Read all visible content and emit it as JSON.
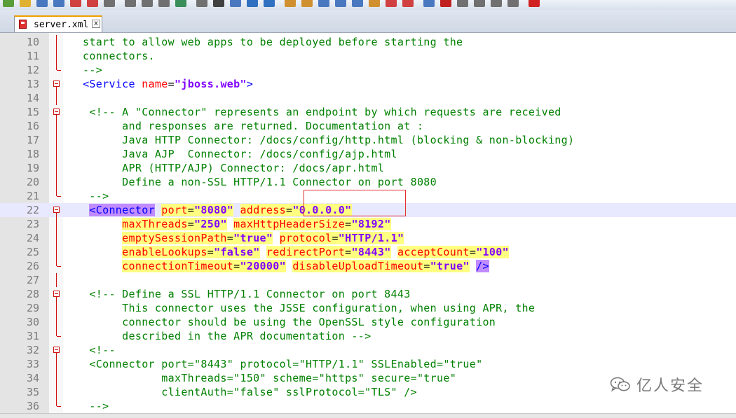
{
  "tab": {
    "filename": "server.xml",
    "close_label": "x"
  },
  "watermark": {
    "text": "亿人安全"
  },
  "colors": {
    "comment": "#008000",
    "tag": "#0000ff",
    "attribute": "#ff0000",
    "value": "#8000ff",
    "line_highlight": "#e8e8ff",
    "match_highlight": "#ffff80",
    "tag_match": "#c08cff",
    "annotation_box": "#e03030"
  },
  "lines": [
    {
      "n": "10",
      "fold": "mid",
      "toks": [
        [
          "cm",
          "   start to allow web apps to be deployed before starting the"
        ]
      ]
    },
    {
      "n": "11",
      "fold": "mid",
      "toks": [
        [
          "cm",
          "   connectors."
        ]
      ]
    },
    {
      "n": "12",
      "fold": "end",
      "toks": [
        [
          "cm",
          "   -->"
        ]
      ]
    },
    {
      "n": "13",
      "fold": "box",
      "toks": [
        [
          "pl",
          "   "
        ],
        [
          "tag",
          "<Service "
        ],
        [
          "attr",
          "name"
        ],
        [
          "eq",
          "="
        ],
        [
          "val",
          "\"jboss.web\""
        ],
        [
          "tag",
          ">"
        ]
      ]
    },
    {
      "n": "14",
      "fold": "mid",
      "toks": []
    },
    {
      "n": "15",
      "fold": "box",
      "toks": [
        [
          "cm",
          "    <!-- A \"Connector\" represents an endpoint by which requests are received"
        ]
      ]
    },
    {
      "n": "16",
      "fold": "mid",
      "toks": [
        [
          "cm",
          "         and responses are returned. Documentation at :"
        ]
      ]
    },
    {
      "n": "17",
      "fold": "mid",
      "toks": [
        [
          "cm",
          "         Java HTTP Connector: /docs/config/http.html (blocking & non-blocking)"
        ]
      ]
    },
    {
      "n": "18",
      "fold": "mid",
      "toks": [
        [
          "cm",
          "         Java AJP  Connector: /docs/config/ajp.html"
        ]
      ]
    },
    {
      "n": "19",
      "fold": "mid",
      "toks": [
        [
          "cm",
          "         APR (HTTP/AJP) Connector: /docs/apr.html"
        ]
      ]
    },
    {
      "n": "20",
      "fold": "mid",
      "toks": [
        [
          "cm",
          "         Define a non-SSL HTTP/1.1 Connector on port 8080"
        ]
      ]
    },
    {
      "n": "21",
      "fold": "end",
      "toks": [
        [
          "cm",
          "    -->"
        ]
      ]
    },
    {
      "n": "22",
      "fold": "box",
      "hl": true,
      "toks": [
        [
          "pl",
          "    "
        ],
        [
          "tag",
          "<Connector",
          "p"
        ],
        [
          "pl",
          " "
        ],
        [
          "attr",
          "port",
          "y"
        ],
        [
          "eq",
          "=",
          "y"
        ],
        [
          "val",
          "\"8080\"",
          "y"
        ],
        [
          "pl",
          " "
        ],
        [
          "attr",
          "address",
          "y"
        ],
        [
          "eq",
          "=",
          "y"
        ],
        [
          "val",
          "\"0.0.0.0\"",
          "y"
        ]
      ]
    },
    {
      "n": "23",
      "fold": "mid",
      "toks": [
        [
          "pl",
          "         "
        ],
        [
          "attr",
          "maxThreads",
          "y"
        ],
        [
          "eq",
          "=",
          "y"
        ],
        [
          "val",
          "\"250\"",
          "y"
        ],
        [
          "pl",
          " "
        ],
        [
          "attr",
          "maxHttpHeaderSize",
          "y"
        ],
        [
          "eq",
          "=",
          "y"
        ],
        [
          "val",
          "\"8192\"",
          "y"
        ]
      ]
    },
    {
      "n": "24",
      "fold": "mid",
      "toks": [
        [
          "pl",
          "         "
        ],
        [
          "attr",
          "emptySessionPath",
          "y"
        ],
        [
          "eq",
          "=",
          "y"
        ],
        [
          "val",
          "\"true\"",
          "y"
        ],
        [
          "pl",
          " "
        ],
        [
          "attr",
          "protocol",
          "y"
        ],
        [
          "eq",
          "=",
          "y"
        ],
        [
          "val",
          "\"HTTP/1.1\"",
          "y"
        ]
      ]
    },
    {
      "n": "25",
      "fold": "mid",
      "toks": [
        [
          "pl",
          "         "
        ],
        [
          "attr",
          "enableLookups",
          "y"
        ],
        [
          "eq",
          "=",
          "y"
        ],
        [
          "val",
          "\"false\"",
          "y"
        ],
        [
          "pl",
          " "
        ],
        [
          "attr",
          "redirectPort",
          "y"
        ],
        [
          "eq",
          "=",
          "y"
        ],
        [
          "val",
          "\"8443\"",
          "y"
        ],
        [
          "pl",
          " "
        ],
        [
          "attr",
          "acceptCount",
          "y"
        ],
        [
          "eq",
          "=",
          "y"
        ],
        [
          "val",
          "\"100\"",
          "y"
        ]
      ]
    },
    {
      "n": "26",
      "fold": "end",
      "toks": [
        [
          "pl",
          "         "
        ],
        [
          "attr",
          "connectionTimeout",
          "y"
        ],
        [
          "eq",
          "=",
          "y"
        ],
        [
          "val",
          "\"20000\"",
          "y"
        ],
        [
          "pl",
          " "
        ],
        [
          "attr",
          "disableUploadTimeout",
          "y"
        ],
        [
          "eq",
          "=",
          "y"
        ],
        [
          "val",
          "\"true\"",
          "y"
        ],
        [
          "pl",
          " "
        ],
        [
          "tag",
          "/>",
          "p"
        ]
      ]
    },
    {
      "n": "27",
      "fold": "mid",
      "toks": []
    },
    {
      "n": "28",
      "fold": "box",
      "toks": [
        [
          "cm",
          "    <!-- Define a SSL HTTP/1.1 Connector on port 8443"
        ]
      ]
    },
    {
      "n": "29",
      "fold": "mid",
      "toks": [
        [
          "cm",
          "         This connector uses the JSSE configuration, when using APR, the"
        ]
      ]
    },
    {
      "n": "30",
      "fold": "mid",
      "toks": [
        [
          "cm",
          "         connector should be using the OpenSSL style configuration"
        ]
      ]
    },
    {
      "n": "31",
      "fold": "end",
      "toks": [
        [
          "cm",
          "         described in the APR documentation -->"
        ]
      ]
    },
    {
      "n": "32",
      "fold": "box",
      "toks": [
        [
          "cm",
          "    <!--"
        ]
      ]
    },
    {
      "n": "33",
      "fold": "mid",
      "toks": [
        [
          "cm",
          "    <Connector port=\"8443\" protocol=\"HTTP/1.1\" SSLEnabled=\"true\""
        ]
      ]
    },
    {
      "n": "34",
      "fold": "mid",
      "toks": [
        [
          "cm",
          "               maxThreads=\"150\" scheme=\"https\" secure=\"true\""
        ]
      ]
    },
    {
      "n": "35",
      "fold": "mid",
      "toks": [
        [
          "cm",
          "               clientAuth=\"false\" sslProtocol=\"TLS\" />"
        ]
      ]
    },
    {
      "n": "36",
      "fold": "end",
      "toks": [
        [
          "cm",
          "    -->"
        ]
      ]
    }
  ]
}
